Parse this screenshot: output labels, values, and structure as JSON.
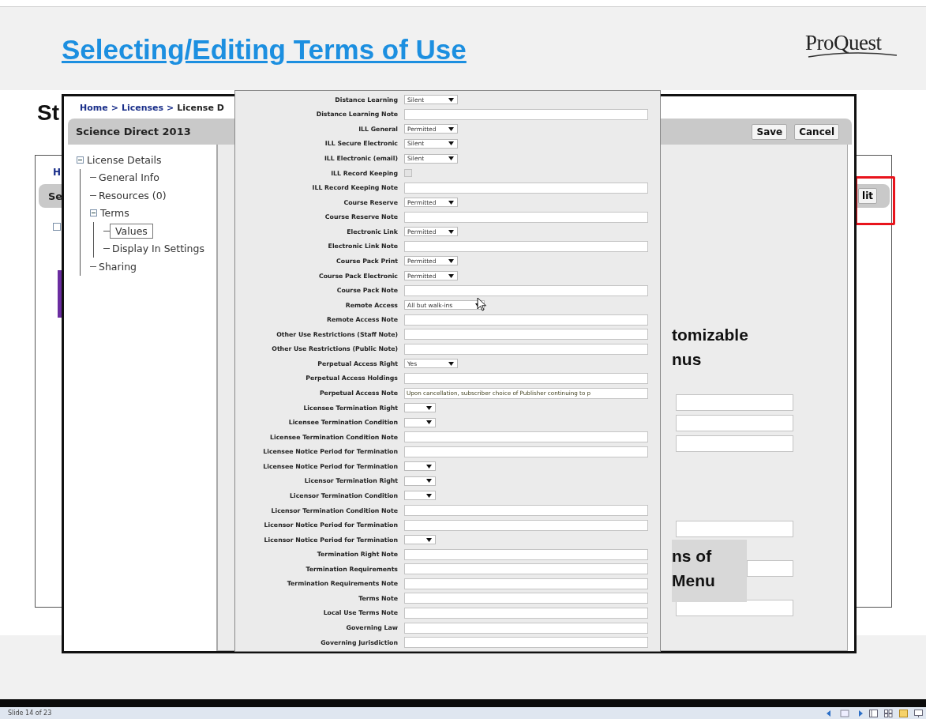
{
  "slide": {
    "title": "Selecting/Editing Terms of Use",
    "logo": "ProQuest",
    "subtitle_fragment": "St",
    "background_app": {
      "breadcrumb_fragment": "H",
      "header_fragment": "Se",
      "edit_button_fragment": "lit",
      "edit_highlighted": true
    },
    "app_window": {
      "breadcrumb": [
        {
          "text": "Home",
          "kind": "link"
        },
        {
          "text": ">",
          "kind": "sep"
        },
        {
          "text": "Licenses",
          "kind": "link"
        },
        {
          "text": ">",
          "kind": "sep"
        },
        {
          "text": "License D",
          "kind": "current"
        }
      ],
      "header_title": "Science Direct 2013",
      "buttons": [
        "Save",
        "Cancel"
      ],
      "tree": [
        {
          "label": "License Details",
          "expanded": true,
          "selected": false,
          "children": [
            {
              "label": "General Info",
              "selected": false
            },
            {
              "label": "Resources (0)",
              "selected": false
            },
            {
              "label": "Terms",
              "expanded": true,
              "selected": false,
              "children": [
                {
                  "label": "Values",
                  "selected": true
                },
                {
                  "label": "Display In Settings",
                  "selected": false
                }
              ]
            },
            {
              "label": "Sharing",
              "selected": false
            }
          ]
        }
      ],
      "callouts": [
        {
          "lines": [
            "tomizable",
            "nus"
          ],
          "shaded": false
        },
        {
          "lines": [
            "ns of",
            "Menu"
          ],
          "shaded": true
        }
      ],
      "form": [
        {
          "label": "Distance Learning",
          "kind": "select",
          "value": "Silent"
        },
        {
          "label": "Distance Learning Note",
          "kind": "text"
        },
        {
          "label": "ILL General",
          "kind": "select",
          "value": "Permitted"
        },
        {
          "label": "ILL Secure Electronic",
          "kind": "select",
          "value": "Silent"
        },
        {
          "label": "ILL Electronic (email)",
          "kind": "select",
          "value": "Silent"
        },
        {
          "label": "ILL Record Keeping",
          "kind": "checkbox",
          "checked": false,
          "disabled": true
        },
        {
          "label": "ILL Record Keeping Note",
          "kind": "text"
        },
        {
          "label": "Course Reserve",
          "kind": "select",
          "value": "Permitted"
        },
        {
          "label": "Course Reserve Note",
          "kind": "text"
        },
        {
          "label": "Electronic Link",
          "kind": "select",
          "value": "Permitted"
        },
        {
          "label": "Electronic Link Note",
          "kind": "text"
        },
        {
          "label": "Course Pack Print",
          "kind": "select",
          "value": "Permitted"
        },
        {
          "label": "Course Pack Electronic",
          "kind": "select",
          "value": "Permitted"
        },
        {
          "label": "Course Pack Note",
          "kind": "text"
        },
        {
          "label": "Remote Access",
          "kind": "select",
          "value": "All but walk-ins"
        },
        {
          "label": "Remote Access Note",
          "kind": "text"
        },
        {
          "label": "Other Use Restrictions (Staff Note)",
          "kind": "text"
        },
        {
          "label": "Other Use Restrictions (Public Note)",
          "kind": "text"
        },
        {
          "label": "Perpetual Access Right",
          "kind": "select",
          "value": "Yes"
        },
        {
          "label": "Perpetual Access Holdings",
          "kind": "text"
        },
        {
          "label": "Perpetual Access Note",
          "kind": "text",
          "value": "Upon cancellation, subscriber choice of Publisher continuing to p"
        },
        {
          "label": "Licensee Termination Right",
          "kind": "select"
        },
        {
          "label": "Licensee Termination Condition",
          "kind": "select"
        },
        {
          "label": "Licensee Termination Condition Note",
          "kind": "text"
        },
        {
          "label": "Licensee Notice Period for Termination",
          "kind": "text"
        },
        {
          "label": "Licensee Notice Period for Termination",
          "kind": "select"
        },
        {
          "label": "Licensor Termination Right",
          "kind": "select"
        },
        {
          "label": "Licensor Termination Condition",
          "kind": "select"
        },
        {
          "label": "Licensor Termination Condition Note",
          "kind": "text"
        },
        {
          "label": "Licensor Notice Period for Termination",
          "kind": "text"
        },
        {
          "label": "Licensor Notice Period for Termination",
          "kind": "select"
        },
        {
          "label": "Termination Right Note",
          "kind": "text"
        },
        {
          "label": "Termination Requirements",
          "kind": "text"
        },
        {
          "label": "Termination Requirements Note",
          "kind": "text"
        },
        {
          "label": "Terms Note",
          "kind": "text"
        },
        {
          "label": "Local Use Terms Note",
          "kind": "text"
        },
        {
          "label": "Governing Law",
          "kind": "text"
        },
        {
          "label": "Governing Jurisdiction",
          "kind": "text"
        }
      ]
    }
  },
  "status_bar": {
    "slide_counter": "Slide 14 of 23"
  }
}
